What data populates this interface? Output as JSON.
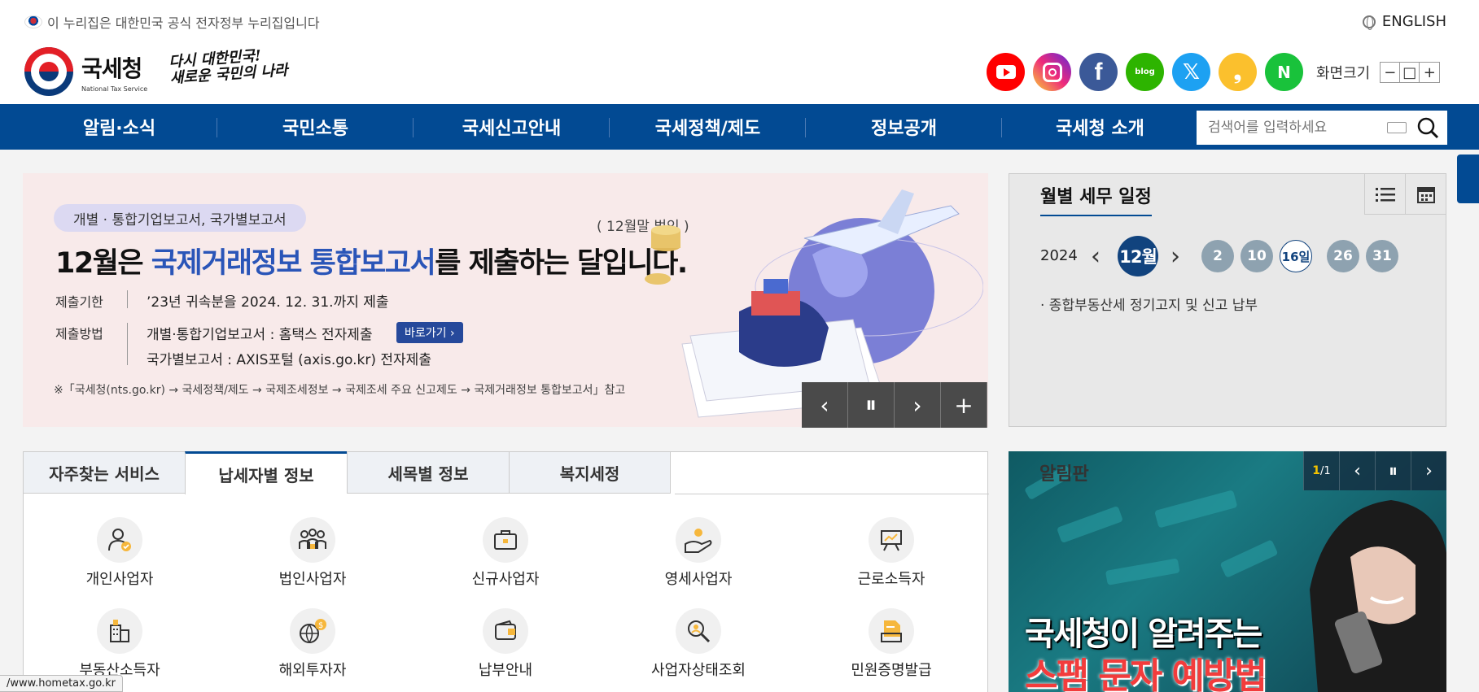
{
  "gov_notice": "이 누리집은 대한민국 공식 전자정부 누리집입니다",
  "lang_label": "ENGLISH",
  "logo": {
    "ko": "국세청",
    "en": "National Tax Service",
    "slogan_line1": "다시 대한민국!",
    "slogan_line2": "새로운 국민의 나라"
  },
  "social": [
    {
      "name": "youtube-icon",
      "glyph": ""
    },
    {
      "name": "instagram-icon",
      "glyph": ""
    },
    {
      "name": "facebook-icon",
      "glyph": "f"
    },
    {
      "name": "blog-icon",
      "glyph": "blog"
    },
    {
      "name": "x-icon",
      "glyph": "𝕏"
    },
    {
      "name": "kakao-story-icon",
      "glyph": "❟"
    },
    {
      "name": "naver-post-icon",
      "glyph": "N"
    }
  ],
  "fontsize": {
    "label": "화면크기",
    "minus": "−",
    "reset": "□",
    "plus": "+"
  },
  "nav": [
    "알림·소식",
    "국민소통",
    "국세신고안내",
    "국세정책/제도",
    "정보공개",
    "국세청 소개"
  ],
  "search": {
    "placeholder": "검색어를 입력하세요"
  },
  "banner": {
    "pill": "개별 · 통합기업보고서, 국가별보고서",
    "period": "( 12월말 법인 )",
    "headline_pre": "12월은 ",
    "headline_hl": "국제거래정보 통합보고서",
    "headline_post": "를 제출하는 달입니다.",
    "deadline_label": "제출기한",
    "deadline_value": "’23년 귀속분을 2024. 12. 31.까지 제출",
    "method_label": "제출방법",
    "method_value1": "개별·통합기업보고서 : 홈택스 전자제출",
    "goto_btn": "바로가기 ›",
    "method_value2": "국가별보고서 : AXIS포털 (axis.go.kr) 전자제출",
    "footnote": "※「국세청(nts.go.kr) → 국세정책/제도 → 국제조세정보 → 국제조세 주요 신고제도 → 국제거래정보 통합보고서」참고"
  },
  "banner_ctrl": {
    "prev": "‹",
    "pause": "⏸",
    "next": "›",
    "more": "+"
  },
  "schedule": {
    "title": "월별 세무 일정",
    "year": "2024",
    "month": "12월",
    "days": [
      "2",
      "10",
      "16일",
      "26",
      "31"
    ],
    "selected_day": "16일",
    "event": "· 종합부동산세 정기고지 및 신고 납부"
  },
  "tabs": [
    "자주찾는 서비스",
    "납세자별 정보",
    "세목별 정보",
    "복지세정"
  ],
  "active_tab": "납세자별 정보",
  "services": [
    {
      "name": "individual-business-icon",
      "label": "개인사업자"
    },
    {
      "name": "corporate-business-icon",
      "label": "법인사업자"
    },
    {
      "name": "new-business-icon",
      "label": "신규사업자"
    },
    {
      "name": "small-business-icon",
      "label": "영세사업자"
    },
    {
      "name": "earned-income-icon",
      "label": "근로소득자"
    },
    {
      "name": "real-estate-icon",
      "label": "부동산소득자"
    },
    {
      "name": "overseas-investor-icon",
      "label": "해외투자자"
    },
    {
      "name": "payment-guide-icon",
      "label": "납부안내"
    },
    {
      "name": "business-status-icon",
      "label": "사업자상태조회"
    },
    {
      "name": "certificate-icon",
      "label": "민원증명발급"
    }
  ],
  "notice": {
    "title": "알림판",
    "pager_current": "1",
    "pager_total": "/1",
    "headline1": "국세청이 알려주는",
    "headline2": "스팸 문자 예방법"
  },
  "status_url": "/www.hometax.go.kr",
  "colors": {
    "nav_bg": "#024a93",
    "highlight": "#2a55b8",
    "month_bg": "#11437e",
    "day_bg": "#8ea2b0"
  }
}
